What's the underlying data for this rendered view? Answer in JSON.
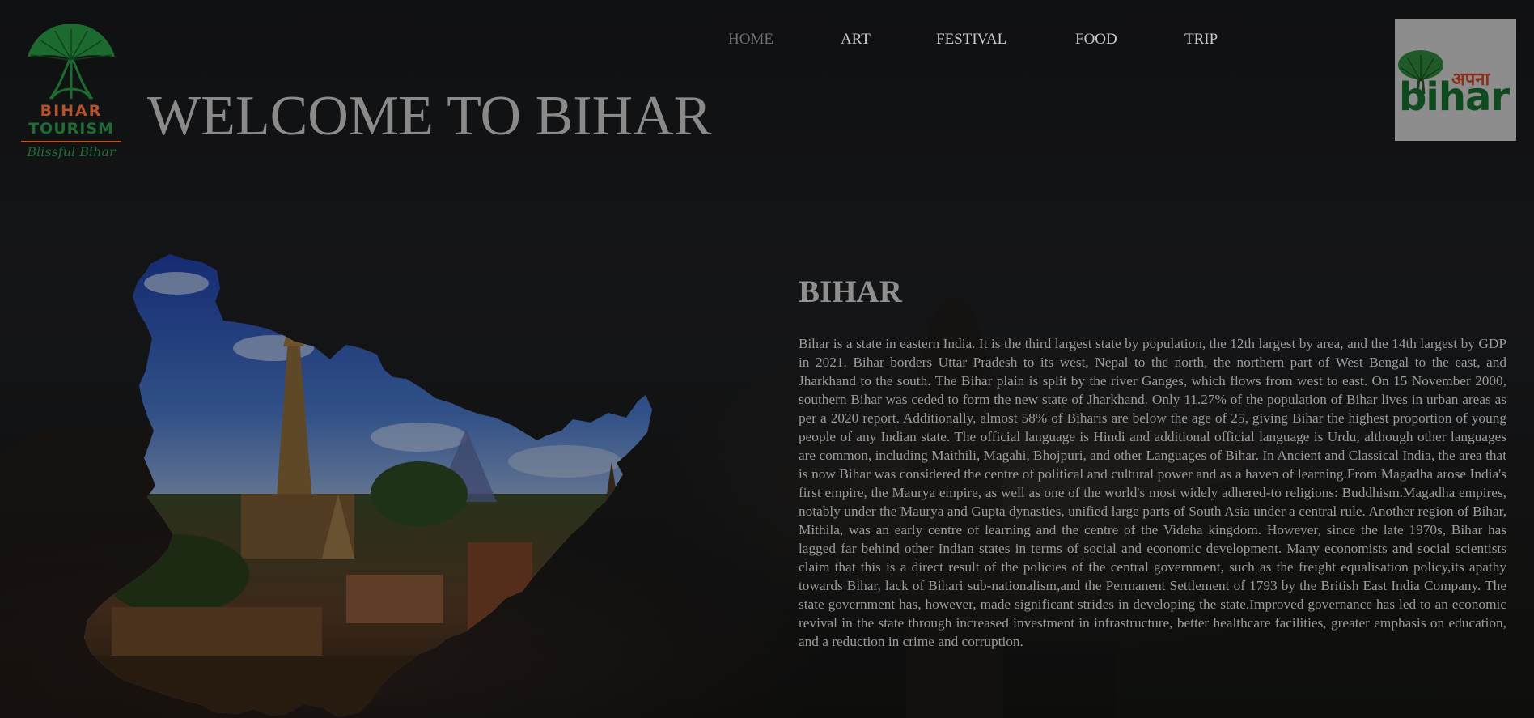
{
  "logo": {
    "line1": "BIHAR",
    "line2": "TOURISM",
    "tagline": "Blissful Bihar",
    "icon": "tree-icon"
  },
  "page_title": "WELCOME TO BIHAR",
  "nav": {
    "items": [
      {
        "label": "HOME",
        "active": true
      },
      {
        "label": "ART",
        "active": false
      },
      {
        "label": "FESTIVAL",
        "active": false
      },
      {
        "label": "FOOD",
        "active": false
      },
      {
        "label": "TRIP",
        "active": false
      }
    ]
  },
  "apna_logo": {
    "word_hindi": "अपना",
    "word_latin": "bihar",
    "icon": "tree-icon"
  },
  "map_image": {
    "icon": "bihar-map-collage-image"
  },
  "section": {
    "title": "BIHAR",
    "body": "Bihar is a state in eastern India. It is the third largest state by population, the 12th largest by area, and the 14th largest by GDP in 2021. Bihar borders Uttar Pradesh to its west, Nepal to the north, the northern part of West Bengal to the east, and Jharkhand to the south. The Bihar plain is split by the river Ganges, which flows from west to east. On 15 November 2000, southern Bihar was ceded to form the new state of Jharkhand. Only 11.27% of the population of Bihar lives in urban areas as per a 2020 report. Additionally, almost 58% of Biharis are below the age of 25, giving Bihar the highest proportion of young people of any Indian state. The official language is Hindi and additional official language is Urdu, although other languages are common, including Maithili, Magahi, Bhojpuri, and other Languages of Bihar. In Ancient and Classical India, the area that is now Bihar was considered the centre of political and cultural power and as a haven of learning.From Magadha arose India's first empire, the Maurya empire, as well as one of the world's most widely adhered-to religions: Buddhism.Magadha empires, notably under the Maurya and Gupta dynasties, unified large parts of South Asia under a central rule. Another region of Bihar, Mithila, was an early centre of learning and the centre of the Videha kingdom. However, since the late 1970s, Bihar has lagged far behind other Indian states in terms of social and economic development. Many economists and social scientists claim that this is a direct result of the policies of the central government, such as the freight equalisation policy,its apathy towards Bihar, lack of Bihari sub-nationalism,and the Permanent Settlement of 1793 by the British East India Company. The state government has, however, made significant strides in developing the state.Improved governance has led to an economic revival in the state through increased investment in infrastructure, better healthcare facilities, greater emphasis on education, and a reduction in crime and corruption."
  },
  "colors": {
    "background": "#0c0d0f",
    "nav_text": "#c9c9c9",
    "nav_active": "#6f6f6f",
    "title": "#8a8a8a",
    "logo_green": "#1f6b34",
    "logo_orange": "#b5542a"
  }
}
